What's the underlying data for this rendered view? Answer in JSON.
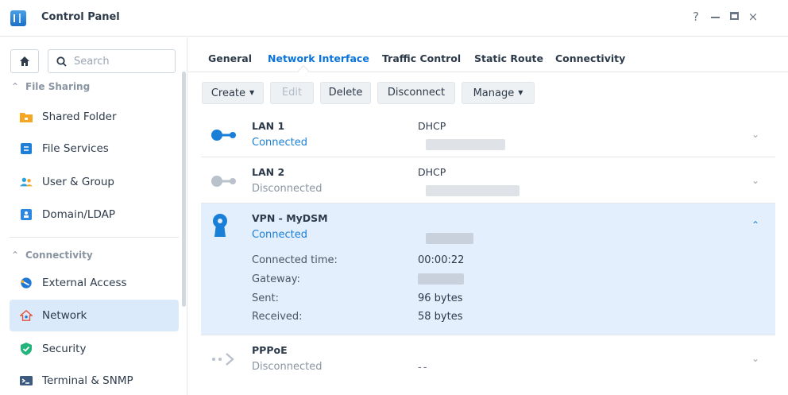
{
  "window": {
    "title": "Control Panel",
    "controls": {
      "help": "?",
      "close": "×"
    }
  },
  "sidebar": {
    "search_placeholder": "Search",
    "sections": [
      {
        "label": "File Sharing"
      },
      {
        "label": "Connectivity"
      }
    ],
    "items": [
      {
        "label": "Shared Folder",
        "icon": "shared-folder-icon",
        "color": "#f5a623"
      },
      {
        "label": "File Services",
        "icon": "file-services-icon",
        "color": "#1f7fd6"
      },
      {
        "label": "User & Group",
        "icon": "user-group-icon",
        "color": "#29a3e0"
      },
      {
        "label": "Domain/LDAP",
        "icon": "domain-ldap-icon",
        "color": "#2c87e0"
      },
      {
        "label": "External Access",
        "icon": "external-access-icon",
        "color": "#1f77d4"
      },
      {
        "label": "Network",
        "icon": "network-icon",
        "color": "#e6533c",
        "active": true
      },
      {
        "label": "Security",
        "icon": "security-icon",
        "color": "#22b47a"
      },
      {
        "label": "Terminal & SNMP",
        "icon": "terminal-snmp-icon",
        "color": "#3d5a80"
      }
    ]
  },
  "tabs": [
    {
      "label": "General"
    },
    {
      "label": "Network Interface",
      "active": true
    },
    {
      "label": "Traffic Control"
    },
    {
      "label": "Static Route"
    },
    {
      "label": "Connectivity"
    }
  ],
  "toolbar": {
    "create": "Create",
    "edit": "Edit",
    "delete": "Delete",
    "disconnect": "Disconnect",
    "manage": "Manage"
  },
  "interfaces": [
    {
      "name": "LAN 1",
      "status": "Connected",
      "protocol": "DHCP"
    },
    {
      "name": "LAN 2",
      "status": "Disconnected",
      "protocol": "DHCP"
    },
    {
      "name": "VPN - MyDSM",
      "status": "Connected",
      "details": [
        {
          "label": "Connected time:",
          "value": "00:00:22"
        },
        {
          "label": "Gateway:",
          "value": ""
        },
        {
          "label": "Sent:",
          "value": "96 bytes"
        },
        {
          "label": "Received:",
          "value": "58 bytes"
        }
      ]
    },
    {
      "name": "PPPoE",
      "status": "Disconnected",
      "protocol": "--"
    }
  ],
  "colors": {
    "accent": "#0a74d9",
    "selected_bg": "#dbeafb",
    "expanded_bg": "#e3effc"
  }
}
